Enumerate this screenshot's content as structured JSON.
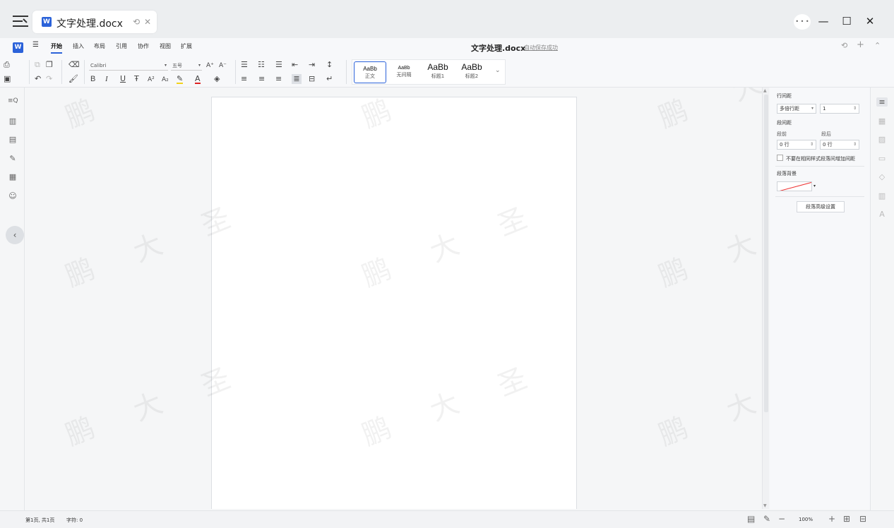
{
  "tab": {
    "title": "文字处理.docx",
    "logo": "W"
  },
  "window": {
    "min": "—",
    "max": "☐",
    "close": "✕",
    "avatar": "• • •"
  },
  "ribbon": {
    "logo": "W",
    "menu": "☰",
    "tabs": [
      "开始",
      "插入",
      "布局",
      "引用",
      "协作",
      "视图",
      "扩展"
    ],
    "active_tab": "开始",
    "doc_title": "文字处理.docx",
    "autosave": "自动保存成功"
  },
  "toolbar": {
    "font_name": "Calibri",
    "font_size": "五号",
    "bold": "B",
    "italic": "I",
    "underline": "U",
    "strike": "Ŧ",
    "sup": "A²",
    "sub": "A₂",
    "grow": "A⁺",
    "shrink": "A⁻",
    "styles": [
      {
        "preview": "AaBb",
        "name": "正文"
      },
      {
        "preview": "AaBb",
        "name": "无间隔"
      },
      {
        "preview": "AaBb",
        "name": "标题1"
      },
      {
        "preview": "AaBb",
        "name": "标题2"
      }
    ]
  },
  "watermark": {
    "chars": [
      "鹏",
      "大",
      "圣"
    ]
  },
  "props": {
    "line_spacing_label": "行间距",
    "line_spacing_mode": "多倍行距",
    "line_spacing_value": "1",
    "para_spacing_label": "段间距",
    "before_label": "段前",
    "after_label": "段后",
    "before_value": "0 行",
    "after_value": "0 行",
    "no_space_same_style": "不要在相同样式段落间增加间距",
    "para_bg_label": "段落背景",
    "advanced_button": "段落高级设置"
  },
  "status": {
    "page_info": "第1页, 共1页",
    "word_count": "字符: 0",
    "zoom": "100%",
    "zoom_out": "−",
    "zoom_in": "+"
  },
  "colors": {
    "accent": "#2b62d9",
    "page_bg": "#ffffff",
    "chrome_bg": "#f5f6f7"
  }
}
